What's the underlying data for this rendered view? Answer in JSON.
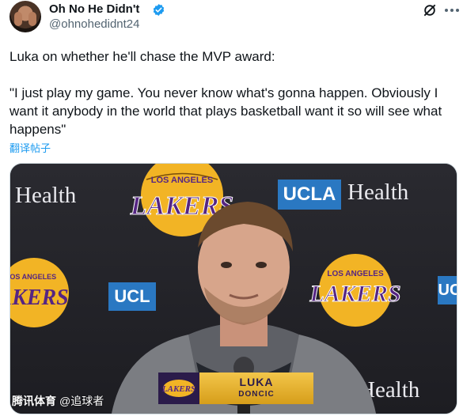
{
  "tweet": {
    "display_name": "Oh No He Didn't",
    "handle": "@ohnohedidnt24",
    "text_line1": "Luka on whether he'll chase the MVP award:",
    "text_line2": "\"I just play my game. You never know what's gonna happen. Obviously I want it anybody in the world that plays basketball want it so will see what happens\"",
    "translate_label": "翻译帖子",
    "icons": {
      "verified": "verified-badge-icon",
      "grok": "grok-icon",
      "more": "more-icon"
    },
    "colors": {
      "verified": "#1d9bf0",
      "link": "#1d9bf0",
      "handle": "#536471"
    }
  },
  "media": {
    "backdrop_texts": {
      "health_left": "Health",
      "health_right": "Health",
      "health_bottom": "Health",
      "ucla_top": "UCLA",
      "ucla_mid": "UCL",
      "ucla_right": "UC"
    },
    "lakers_text_top": "LOS ANGELES",
    "lakers_text_main": "LAKERS",
    "lower_third": {
      "first_name": "LUKA",
      "last_name": "DONCIC",
      "logo_text": "LAKERS"
    },
    "watermark": {
      "brand": "腾讯体育",
      "handle": "@追球者"
    },
    "colors": {
      "lakers_gold": "#f2b425",
      "lakers_purple": "#552583",
      "ucla_blue": "#2a78c2"
    }
  }
}
